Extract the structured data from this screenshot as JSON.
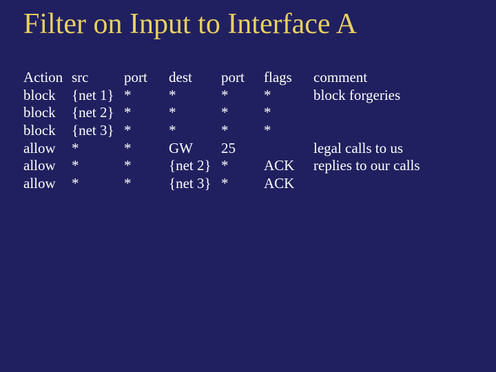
{
  "title": "Filter on Input to Interface A",
  "headers": {
    "action": "Action",
    "src": "src",
    "port1": "port",
    "dest": "dest",
    "port2": "port",
    "flags": "flags",
    "comment": "comment"
  },
  "rows": [
    {
      "action": "block",
      "src": "{net 1}",
      "port1": "*",
      "dest": "*",
      "port2": "*",
      "flags": "*",
      "comment": "block forgeries"
    },
    {
      "action": "block",
      "src": "{net 2}",
      "port1": "*",
      "dest": "*",
      "port2": "*",
      "flags": "*",
      "comment": ""
    },
    {
      "action": "block",
      "src": "{net 3}",
      "port1": "*",
      "dest": "*",
      "port2": "*",
      "flags": "*",
      "comment": ""
    },
    {
      "action": "allow",
      "src": "*",
      "port1": "*",
      "dest": "GW",
      "port2": "25",
      "flags": "",
      "comment": "legal calls to us"
    },
    {
      "action": "allow",
      "src": "*",
      "port1": "*",
      "dest": "{net 2}",
      "port2": "*",
      "flags": "ACK",
      "comment": "replies to our calls"
    },
    {
      "action": "allow",
      "src": "*",
      "port1": "*",
      "dest": "{net 3}",
      "port2": "*",
      "flags": "ACK",
      "comment": ""
    }
  ]
}
